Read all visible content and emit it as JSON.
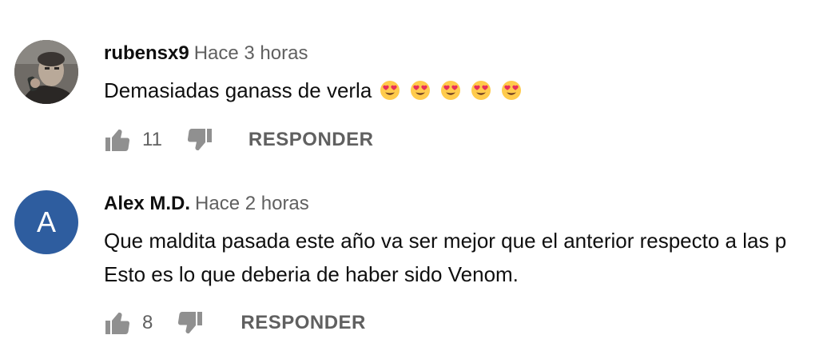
{
  "comments": [
    {
      "author": "rubensx9",
      "time": "Hace 3 horas",
      "text": "Demasiadas ganass de verla",
      "emoji_count": 5,
      "likes": "11",
      "reply_label": "RESPONDER",
      "avatar_type": "photo"
    },
    {
      "author": "Alex M.D.",
      "time": "Hace 2 horas",
      "text_lines": [
        "Que maldita pasada este año va ser mejor que el anterior respecto a las p",
        "Esto es lo que deberia de haber sido Venom."
      ],
      "likes": "8",
      "reply_label": "RESPONDER",
      "avatar_letter": "A",
      "avatar_color": "#2e5d9f"
    }
  ],
  "colors": {
    "primary_text": "#0f0f0f",
    "secondary_text": "#606060",
    "icon": "#909090"
  }
}
